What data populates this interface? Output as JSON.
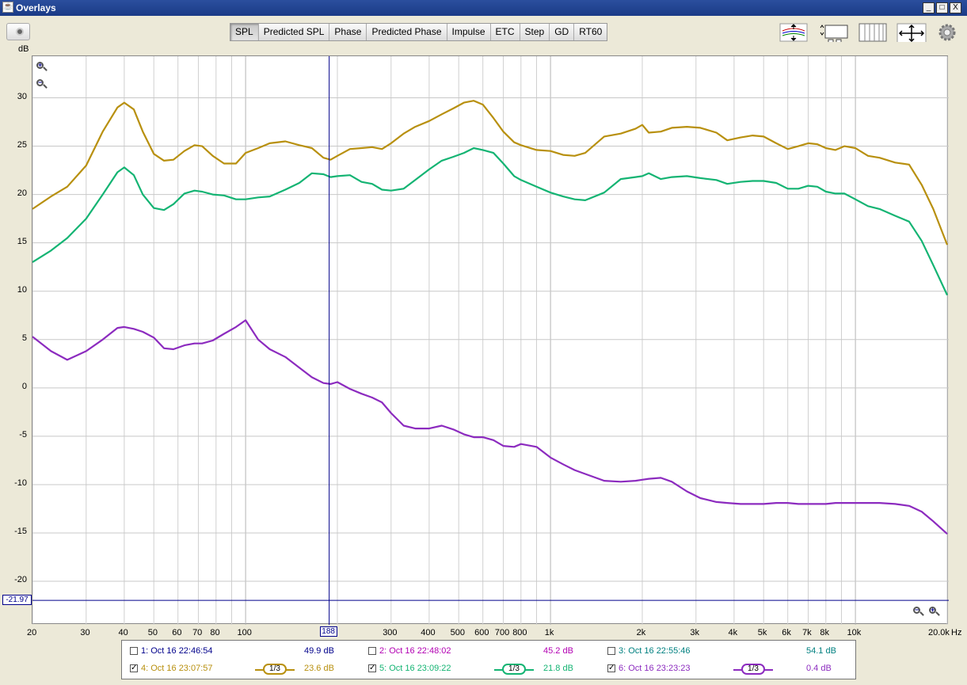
{
  "window": {
    "title": "Overlays",
    "minimize": "_",
    "maximize": "□",
    "close": "X"
  },
  "tabs": [
    {
      "label": "SPL",
      "active": true
    },
    {
      "label": "Predicted SPL",
      "active": false
    },
    {
      "label": "Phase",
      "active": false
    },
    {
      "label": "Predicted Phase",
      "active": false
    },
    {
      "label": "Impulse",
      "active": false
    },
    {
      "label": "ETC",
      "active": false
    },
    {
      "label": "Step",
      "active": false
    },
    {
      "label": "GD",
      "active": false
    },
    {
      "label": "RT60",
      "active": false
    }
  ],
  "toolbar_icons": [
    "camera-icon",
    "arrange-traces-icon",
    "controls-icon",
    "grid-icon",
    "limits-icon",
    "gear-icon"
  ],
  "cursor": {
    "x_label": "188",
    "y_label": "-21.97",
    "x_value": 188,
    "y_value": -21.97
  },
  "legend": [
    {
      "id": "1",
      "label": "1: Oct 16 22:46:54",
      "value": "49.9 dB",
      "checked": false,
      "color": "#00008b",
      "smoothing": ""
    },
    {
      "id": "2",
      "label": "2: Oct 16 22:48:02",
      "value": "45.2 dB",
      "checked": false,
      "color": "#b300b3",
      "smoothing": ""
    },
    {
      "id": "3",
      "label": "3: Oct 16 22:55:46",
      "value": "54.1 dB",
      "checked": false,
      "color": "#008080",
      "smoothing": ""
    },
    {
      "id": "4",
      "label": "4: Oct 16 23:07:57",
      "value": "23.6 dB",
      "checked": true,
      "color": "#b8900f",
      "smoothing": "1/3"
    },
    {
      "id": "5",
      "label": "5: Oct 16 23:09:22",
      "value": "21.8 dB",
      "checked": true,
      "color": "#14b473",
      "smoothing": "1/3"
    },
    {
      "id": "6",
      "label": "6: Oct 16 23:23:23",
      "value": "0.4 dB",
      "checked": true,
      "color": "#8c2bbf",
      "smoothing": "1/3"
    }
  ],
  "chart_data": {
    "type": "line",
    "title": "",
    "xlabel": "Hz",
    "ylabel": "dB",
    "x_scale": "log",
    "xlim": [
      20,
      20000
    ],
    "ylim": [
      -24.5,
      34.3
    ],
    "x_ticks": [
      20,
      30,
      40,
      50,
      60,
      70,
      80,
      100,
      300,
      400,
      500,
      600,
      700,
      800,
      1000,
      2000,
      3000,
      4000,
      5000,
      6000,
      7000,
      8000,
      10000,
      20000
    ],
    "x_tick_labels": [
      "20",
      "30",
      "40",
      "50",
      "60",
      "70",
      "80",
      "100",
      "300",
      "400",
      "500",
      "600",
      "700",
      "800",
      "1k",
      "2k",
      "3k",
      "4k",
      "5k",
      "6k",
      "7k",
      "8k",
      "10k",
      "20.0k"
    ],
    "y_ticks": [
      -20,
      -15,
      -10,
      -5,
      0,
      5,
      10,
      15,
      20,
      25,
      30
    ],
    "grid": true,
    "series": [
      {
        "name": "4: Oct 16 23:07:57",
        "color": "#b8900f",
        "x": [
          20,
          23,
          26,
          30,
          34,
          38,
          40,
          43,
          46,
          50,
          54,
          58,
          63,
          68,
          72,
          78,
          85,
          93,
          100,
          110,
          120,
          135,
          150,
          165,
          180,
          190,
          200,
          220,
          240,
          260,
          280,
          300,
          330,
          360,
          400,
          440,
          480,
          520,
          560,
          600,
          650,
          700,
          760,
          800,
          900,
          1000,
          1100,
          1200,
          1300,
          1500,
          1700,
          1900,
          2000,
          2100,
          2300,
          2500,
          2800,
          3100,
          3500,
          3800,
          4200,
          4600,
          5000,
          5500,
          6000,
          6500,
          7000,
          7500,
          8000,
          8600,
          9200,
          10000,
          11000,
          12000,
          13500,
          15000,
          16500,
          18000,
          20000
        ],
        "y": [
          18.5,
          19.8,
          20.8,
          23,
          26.5,
          29,
          29.5,
          28.8,
          26.5,
          24.2,
          23.5,
          23.6,
          24.5,
          25.1,
          25,
          24,
          23.2,
          23.2,
          24.3,
          24.8,
          25.3,
          25.5,
          25.1,
          24.8,
          23.8,
          23.6,
          24,
          24.7,
          24.8,
          24.9,
          24.7,
          25.3,
          26.3,
          27,
          27.6,
          28.3,
          28.9,
          29.5,
          29.7,
          29.3,
          27.9,
          26.5,
          25.4,
          25.1,
          24.6,
          24.5,
          24.1,
          24,
          24.3,
          26,
          26.3,
          26.8,
          27.2,
          26.4,
          26.5,
          26.9,
          27,
          26.9,
          26.4,
          25.6,
          25.9,
          26.1,
          26,
          25.3,
          24.7,
          25,
          25.3,
          25.2,
          24.8,
          24.6,
          25,
          24.8,
          24,
          23.8,
          23.3,
          23.1,
          21,
          18.5,
          14.8
        ]
      },
      {
        "name": "5: Oct 16 23:09:22",
        "color": "#14b473",
        "x": [
          20,
          23,
          26,
          30,
          34,
          38,
          40,
          43,
          46,
          50,
          54,
          58,
          63,
          68,
          72,
          78,
          85,
          93,
          100,
          110,
          120,
          135,
          150,
          165,
          180,
          190,
          200,
          220,
          240,
          260,
          280,
          300,
          330,
          360,
          400,
          440,
          480,
          520,
          560,
          600,
          650,
          700,
          760,
          800,
          900,
          1000,
          1100,
          1200,
          1300,
          1500,
          1700,
          1900,
          2000,
          2100,
          2300,
          2500,
          2800,
          3100,
          3500,
          3800,
          4200,
          4600,
          5000,
          5500,
          6000,
          6500,
          7000,
          7500,
          8000,
          8600,
          9200,
          10000,
          11000,
          12000,
          13500,
          15000,
          16500,
          18000,
          20000
        ],
        "y": [
          13,
          14.2,
          15.5,
          17.5,
          20,
          22.3,
          22.8,
          22,
          20,
          18.6,
          18.4,
          19,
          20.1,
          20.4,
          20.3,
          20,
          19.9,
          19.5,
          19.5,
          19.7,
          19.8,
          20.5,
          21.2,
          22.2,
          22.1,
          21.8,
          21.9,
          22,
          21.3,
          21.1,
          20.5,
          20.4,
          20.6,
          21.5,
          22.6,
          23.5,
          23.9,
          24.3,
          24.8,
          24.6,
          24.3,
          23.2,
          21.9,
          21.5,
          20.8,
          20.2,
          19.8,
          19.5,
          19.4,
          20.2,
          21.6,
          21.8,
          21.9,
          22.2,
          21.6,
          21.8,
          21.9,
          21.7,
          21.5,
          21.1,
          21.3,
          21.4,
          21.4,
          21.2,
          20.6,
          20.6,
          20.9,
          20.8,
          20.3,
          20.1,
          20.1,
          19.5,
          18.8,
          18.5,
          17.8,
          17.2,
          15.2,
          12.7,
          9.6
        ]
      },
      {
        "name": "6: Oct 16 23:23:23",
        "color": "#8c2bbf",
        "x": [
          20,
          23,
          26,
          30,
          34,
          38,
          40,
          43,
          46,
          50,
          54,
          58,
          63,
          68,
          72,
          78,
          85,
          93,
          100,
          110,
          120,
          135,
          150,
          165,
          180,
          190,
          200,
          220,
          240,
          260,
          280,
          300,
          330,
          360,
          400,
          440,
          480,
          520,
          560,
          600,
          650,
          700,
          760,
          800,
          900,
          1000,
          1100,
          1200,
          1300,
          1500,
          1700,
          1900,
          2000,
          2100,
          2300,
          2500,
          2800,
          3100,
          3500,
          3800,
          4200,
          4600,
          5000,
          5500,
          6000,
          6500,
          7000,
          7500,
          8000,
          8600,
          9200,
          10000,
          11000,
          12000,
          13500,
          15000,
          16500,
          18000,
          20000
        ],
        "y": [
          5.3,
          3.8,
          2.9,
          3.8,
          5,
          6.2,
          6.3,
          6.1,
          5.8,
          5.2,
          4.1,
          4,
          4.4,
          4.6,
          4.6,
          4.9,
          5.6,
          6.3,
          7,
          5,
          4,
          3.2,
          2.1,
          1.1,
          0.5,
          0.4,
          0.6,
          -0.1,
          -0.6,
          -1,
          -1.5,
          -2.6,
          -3.9,
          -4.2,
          -4.2,
          -3.9,
          -4.3,
          -4.8,
          -5.1,
          -5.1,
          -5.4,
          -6,
          -6.1,
          -5.8,
          -6.1,
          -7.2,
          -7.9,
          -8.5,
          -8.9,
          -9.6,
          -9.7,
          -9.6,
          -9.5,
          -9.4,
          -9.3,
          -9.7,
          -10.7,
          -11.4,
          -11.8,
          -11.9,
          -12,
          -12,
          -12,
          -11.9,
          -11.9,
          -12,
          -12,
          -12,
          -12,
          -11.9,
          -11.9,
          -11.9,
          -11.9,
          -11.9,
          -12,
          -12.2,
          -12.8,
          -13.8,
          -15.1
        ]
      }
    ]
  }
}
